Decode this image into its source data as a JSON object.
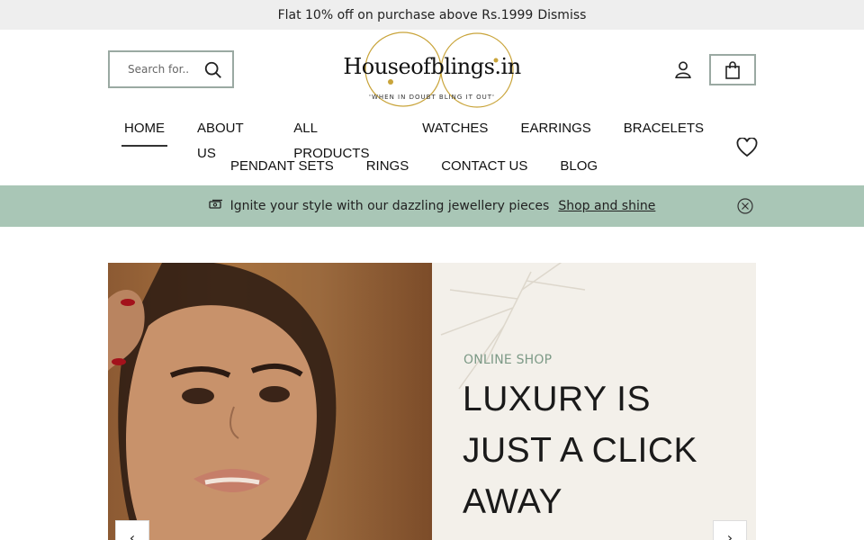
{
  "announcement": {
    "text": "Flat 10% off on purchase above Rs.1999",
    "dismiss_label": "Dismiss"
  },
  "header": {
    "search_placeholder": "Search for..",
    "logo": {
      "wordmark": "Houseofblings.in",
      "tagline": "'WHEN IN DOUBT BLING IT OUT'"
    }
  },
  "nav": {
    "row1": [
      {
        "label": "HOME",
        "active": true
      },
      {
        "label": "ABOUT US"
      },
      {
        "label": "ALL PRODUCTS"
      },
      {
        "label": "WATCHES"
      },
      {
        "label": "EARRINGS"
      },
      {
        "label": "BRACELETS"
      }
    ],
    "row2": [
      {
        "label": "PENDANT SETS"
      },
      {
        "label": "RINGS"
      },
      {
        "label": "CONTACT US"
      },
      {
        "label": "BLOG"
      }
    ]
  },
  "promo": {
    "text": "Ignite your style with our dazzling jewellery pieces",
    "link": "Shop and shine",
    "icon": "gem-icon"
  },
  "hero": {
    "eyebrow": "ONLINE SHOP",
    "headline": "LUXURY IS JUST A CLICK",
    "headline_tail": "AWAY",
    "prev_arrow": "‹",
    "next_arrow": "›"
  },
  "colors": {
    "promo_bg": "#a9c6b6",
    "accent_green": "#7d9a87",
    "logo_gold": "#c9a43a",
    "topbar_bg": "#eeeeee"
  }
}
